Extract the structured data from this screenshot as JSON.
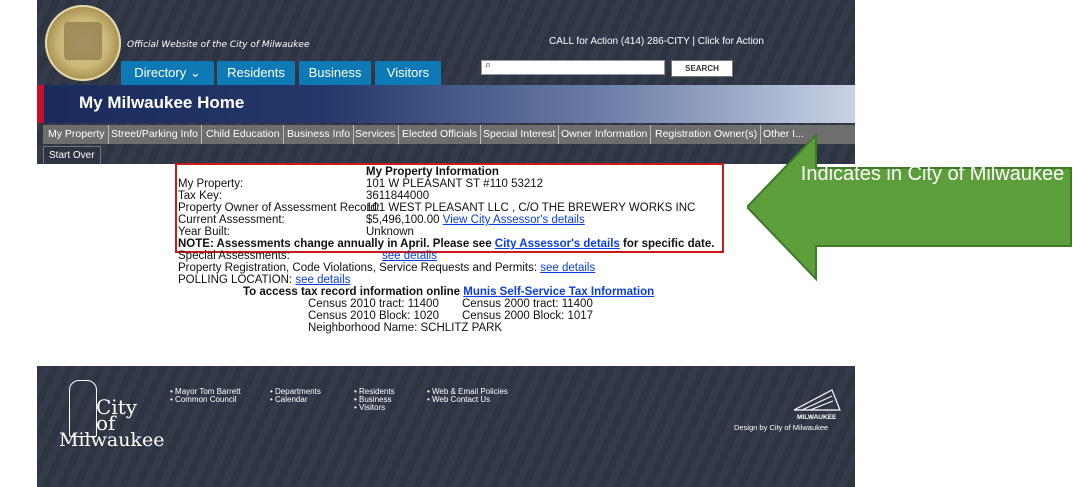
{
  "header": {
    "official": "Official Website of the City of Milwaukee",
    "call_action": "CALL for Action (414) 286-CITY | Click for Action",
    "search_button": "SEARCH",
    "search_icon": "⌕"
  },
  "tabs": [
    {
      "label": "Directory ⌄"
    },
    {
      "label": "Residents"
    },
    {
      "label": "Business"
    },
    {
      "label": "Visitors"
    }
  ],
  "banner": {
    "title": "My Milwaukee Home"
  },
  "nav": [
    "My Property",
    "Street/Parking Info",
    "Child Education",
    "Business Info",
    "Services",
    "Elected Officials",
    "Special Interest",
    "Owner Information",
    "Registration Owner(s)",
    "Other I..."
  ],
  "start_over": "Start Over",
  "property": {
    "heading": "My Property Information",
    "rows": [
      {
        "label": "My Property:",
        "value": "101 W PLEASANT ST #110 53212"
      },
      {
        "label": "Tax Key:",
        "value": "3611844000"
      },
      {
        "label": "Property Owner of Assessment Record:",
        "value": "101 WEST PLEASANT LLC , C/O THE BREWERY WORKS INC"
      },
      {
        "label": "Current Assessment:",
        "value": "$5,496,100.00"
      },
      {
        "label": "Year Built:",
        "value": "Unknown"
      }
    ],
    "assessor_link": "View City Assessor's details"
  },
  "note": {
    "prefix": "NOTE: Assessments change annually in April. Please see ",
    "link": "City Assessor's details",
    "suffix": " for specific date."
  },
  "special": {
    "label": "Special Assessments:",
    "link": "see details"
  },
  "registration": {
    "text": "Property Registration, Code Violations, Service Requests and Permits:",
    "link": "see details"
  },
  "polling": {
    "label": "POLLING LOCATION:",
    "link": "see details"
  },
  "tax": {
    "prefix": "To access tax record information online",
    "link": "Munis Self-Service Tax Information"
  },
  "census": {
    "tract2010": "Census 2010 tract:   11400",
    "tract2000": "Census 2000 tract:  11400",
    "block2010": "Census 2010 Block:  1020",
    "block2000": "Census 2000 Block: 1017",
    "neighborhood": "Neighborhood Name: SCHLITZ PARK"
  },
  "footer": {
    "col1": [
      "• Mayor Tom Barrett",
      "• Common Council"
    ],
    "col2": [
      "• Departments",
      "• Calendar"
    ],
    "col3": [
      "• Residents",
      "• Business",
      "• Visitors"
    ],
    "col4": [
      "• Web & Email Policies",
      "• Web Contact Us"
    ],
    "city_logo": [
      "City",
      "of",
      "Milwaukee"
    ],
    "mke_logo": "MILWAUKEE",
    "design": "Design by City of Milwaukee"
  },
  "callout": {
    "text": "Indicates in City of Milwaukee",
    "color": "#5b9e3a"
  }
}
